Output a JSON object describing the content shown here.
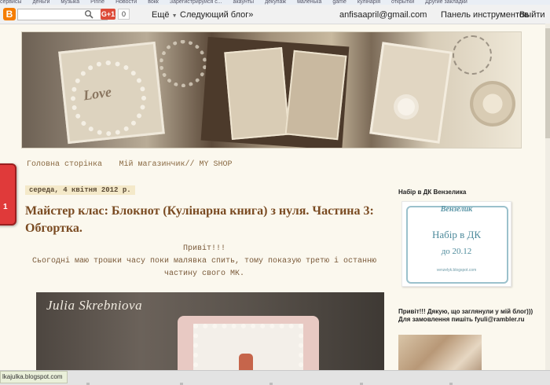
{
  "bookmarks": [
    "сервисы",
    "деньги",
    "музыка",
    "Pinne",
    "Новости",
    "вокк",
    "Зарегистрируйся с...",
    "акаунты",
    "декупаж",
    "маленька",
    "game",
    "кулінарія",
    "открытки",
    "Другие закладки"
  ],
  "navbar": {
    "logo": "B",
    "search_placeholder": "",
    "gplus_label": "G+1",
    "gplus_count": "0",
    "more_label": "Ещё",
    "next_blog_label": "Следующий блог»",
    "email": "anfisaapril@gmail.com",
    "dashboard_label": "Панель инструментов",
    "exit_label": "Выйти"
  },
  "side_tab": {
    "label": "1"
  },
  "page_nav": {
    "items": [
      "Головна сторінка",
      "Мій магазинчик// MY SHOP"
    ]
  },
  "post": {
    "date": "середа, 4 квітня 2012 р.",
    "title": "Майстер клас: Блокнот (Кулінарна книга) з нуля. Частина 3: Обгортка.",
    "greeting": "Привіт!!!",
    "body": "Сьогодні маю трошки часу поки малявка спить, тому показую третю і останню частину свого МК.",
    "image_watermark": "Julia Skrebniova"
  },
  "sidebar": {
    "widget1_title": "Набір в ДК Вензелика",
    "card_brand": "Вензелик",
    "card_line1": "Набір в ДК",
    "card_line2": "до 20.12",
    "card_url": "venzelyk.blogspot.com",
    "widget2_title": "Привіт!!! Дякую, що заглянули у мій блог))) Для замовлення пишіть fyuli@rambler.ru"
  },
  "status_bar": {
    "url": "lkajulka.blogspot.com"
  }
}
